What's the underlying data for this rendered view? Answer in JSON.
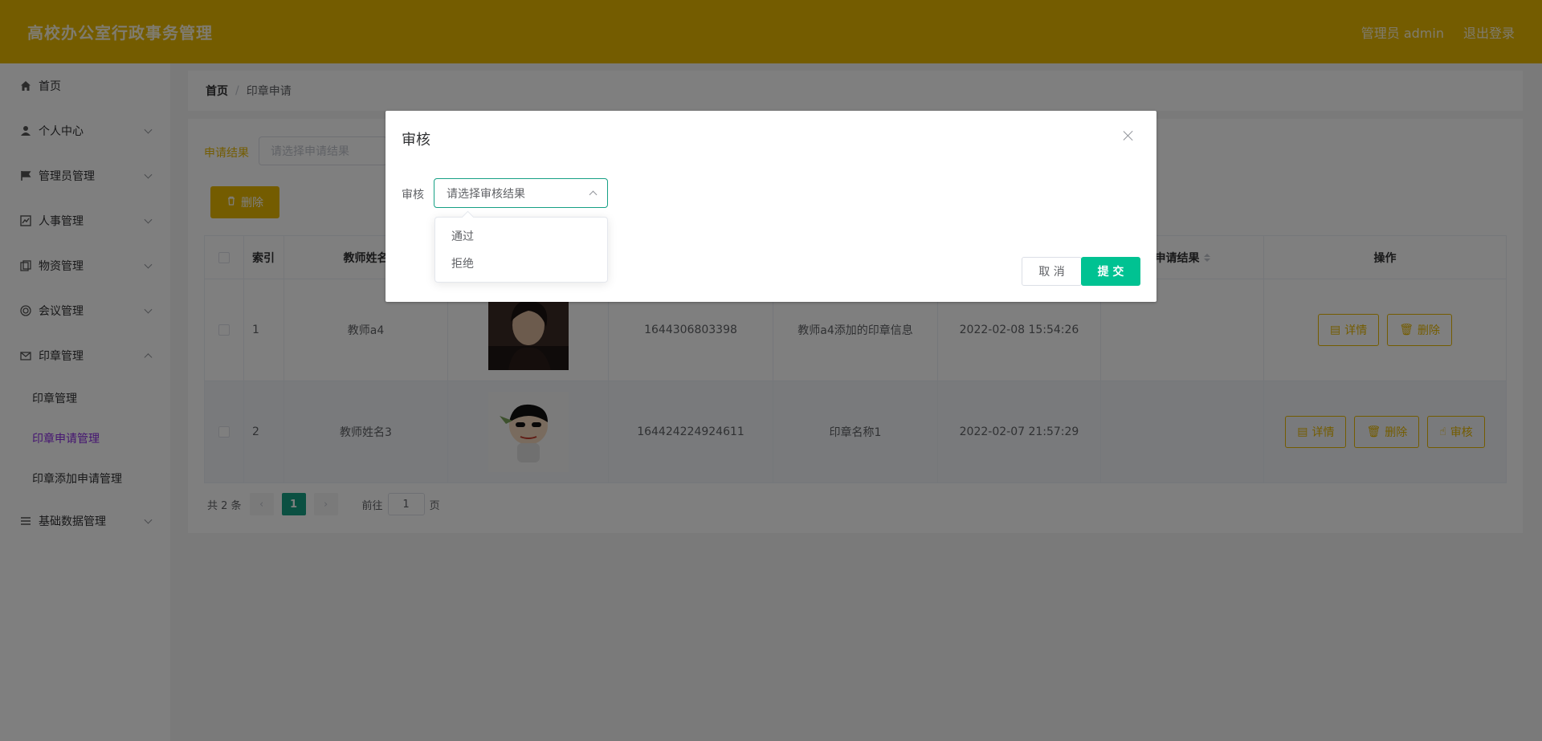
{
  "header": {
    "title": "高校办公室行政事务管理",
    "admin": "管理员 admin",
    "logout": "退出登录"
  },
  "sidebar": {
    "items": [
      {
        "label": "首页",
        "icon": "home-icon"
      },
      {
        "label": "个人中心",
        "icon": "user-icon"
      },
      {
        "label": "管理员管理",
        "icon": "flag-icon"
      },
      {
        "label": "人事管理",
        "icon": "chart-icon"
      },
      {
        "label": "物资管理",
        "icon": "copy-icon"
      },
      {
        "label": "会议管理",
        "icon": "circle-icon"
      },
      {
        "label": "印章管理",
        "icon": "mail-icon"
      }
    ],
    "sub_items": [
      "印章管理",
      "印章申请管理",
      "印章添加申请管理"
    ],
    "last_item": {
      "label": "基础数据管理",
      "icon": "list-icon"
    }
  },
  "breadcrumb": {
    "home": "首页",
    "sep": "/",
    "current": "印章申请"
  },
  "filter": {
    "label": "申请结果",
    "placeholder": "请选择申请结果"
  },
  "toolbar": {
    "delete_label": "删除"
  },
  "table": {
    "headers": [
      "索引",
      "教师姓名",
      "",
      "",
      "",
      "",
      "申请结果",
      "操作"
    ],
    "rows": [
      {
        "index": "1",
        "teacher": "教师a4",
        "code": "1644306803398",
        "info": "教师a4添加的印章信息",
        "time": "2022-02-08 15:54:26",
        "result": ""
      },
      {
        "index": "2",
        "teacher": "教师姓名3",
        "code": "164424224924611",
        "info": "印章名称1",
        "time": "2022-02-07 21:57:29",
        "result": ""
      }
    ],
    "actions": {
      "detail": "详情",
      "delete": "删除",
      "review": "审核"
    }
  },
  "pagination": {
    "total": "共 2 条",
    "current": "1",
    "goto": "前往",
    "page_value": "1",
    "page_unit": "页"
  },
  "dialog": {
    "title": "审核",
    "field_label": "审核",
    "select_placeholder": "请选择审核结果",
    "options": [
      "通过",
      "拒绝"
    ],
    "cancel": "取 消",
    "submit": "提 交"
  },
  "colors": {
    "header": "#e8b800",
    "primary": "#00c292",
    "active_menu": "#8a2be2"
  }
}
